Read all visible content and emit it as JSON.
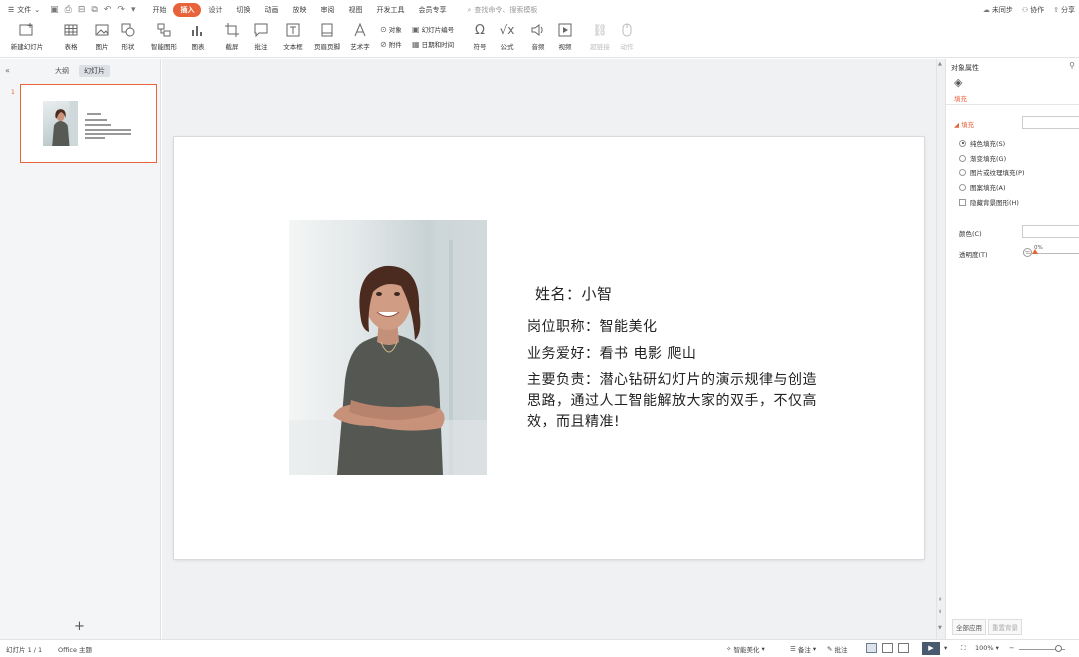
{
  "menubar": {
    "file_label": "文件",
    "tabs": [
      "开始",
      "插入",
      "设计",
      "切换",
      "动画",
      "放映",
      "审阅",
      "视图",
      "开发工具",
      "会员专享"
    ],
    "active_tab": "插入",
    "search_placeholder": "查找命令、搜索模板",
    "right": {
      "sync": "未同步",
      "collab": "协作",
      "share": "分享"
    }
  },
  "ribbon": {
    "new_slide": "新建幻灯片",
    "table": "表格",
    "picture": "图片",
    "shape": "形状",
    "smartart": "智能图形",
    "chart": "图表",
    "screenshot": "截屏",
    "comment": "批注",
    "textbox": "文本框",
    "header_footer": "页眉页脚",
    "wordart": "艺术字",
    "object": "对象",
    "slide_number": "幻灯片编号",
    "attachment": "附件",
    "datetime": "日期和时间",
    "symbol": "符号",
    "formula": "公式",
    "audio": "音频",
    "video": "视频",
    "hyperlink": "超链接",
    "action": "动作"
  },
  "leftpanel": {
    "tab_outline": "大纲",
    "tab_slides": "幻灯片",
    "slide_number": "1"
  },
  "slide": {
    "name": "姓名：小智",
    "job": "岗位职称：智能美化",
    "hobby": "业务爱好：看书  电影 爬山",
    "duty": "主要负责：潜心钻研幻灯片的演示规律与创造思路，通过人工智能解放大家的双手，不仅高效，而且精准!"
  },
  "rightpanel": {
    "title": "对象属性",
    "fill_tab": "填充",
    "fill_section": "填充",
    "options": [
      "纯色填充(S)",
      "渐变填充(G)",
      "图片或纹理填充(P)",
      "图案填充(A)"
    ],
    "selected_option": "纯色填充(S)",
    "hide_bg": "隐藏背景图形(H)",
    "color_label": "颜色(C)",
    "transparency_label": "透明度(T)",
    "transparency_value": "0%",
    "apply_all": "全部应用",
    "reset_bg": "重置背景"
  },
  "statusbar": {
    "slide_info": "幻灯片 1 / 1",
    "theme": "Office 主题",
    "smart_beautify": "智能美化",
    "notes": "备注",
    "comments": "批注",
    "zoom": "100%"
  },
  "colors": {
    "accent": "#e8623a",
    "panel_bg": "#f4f5f7",
    "canvas_bg": "#f0f1f3"
  }
}
